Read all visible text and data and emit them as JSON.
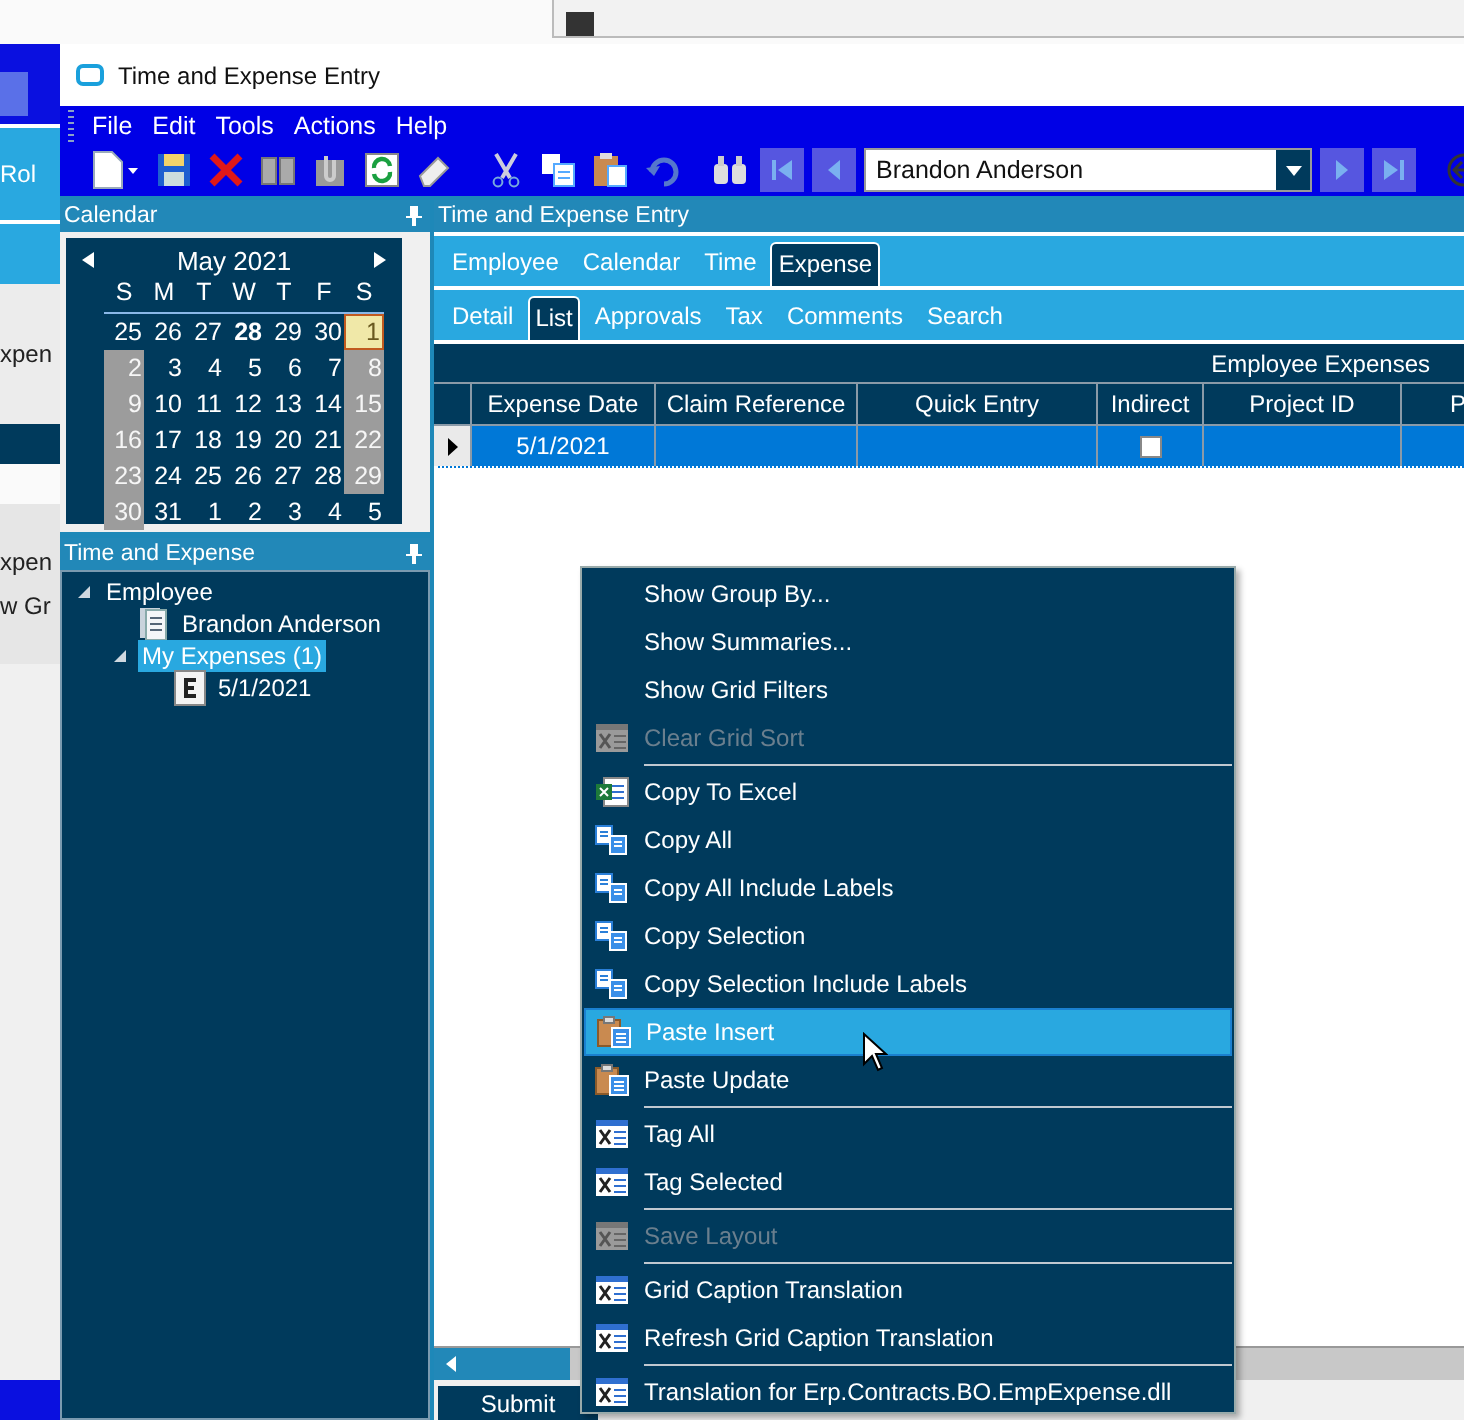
{
  "background_window": {
    "texts": [
      "Rol",
      "xpen",
      "xpen",
      "w Gr"
    ]
  },
  "window": {
    "title": "Time and Expense Entry"
  },
  "menu_bar": [
    "File",
    "Edit",
    "Tools",
    "Actions",
    "Help"
  ],
  "toolbar": {
    "record_selector": {
      "value": "Brandon Anderson"
    }
  },
  "calendar_panel": {
    "title": "Calendar",
    "month": "May 2021",
    "weekdays": [
      "S",
      "M",
      "T",
      "W",
      "T",
      "F",
      "S"
    ],
    "weeks": [
      [
        {
          "day": "25",
          "kind": "day",
          "selected": false
        },
        {
          "day": "26",
          "kind": "day",
          "selected": false
        },
        {
          "day": "27",
          "kind": "day",
          "selected": false
        },
        {
          "day": "28",
          "kind": "bold",
          "selected": false
        },
        {
          "day": "29",
          "kind": "day",
          "selected": false
        },
        {
          "day": "30",
          "kind": "day",
          "selected": false
        },
        {
          "day": "1",
          "kind": "weekend",
          "selected": true
        }
      ],
      [
        {
          "day": "2",
          "kind": "weekend",
          "selected": false
        },
        {
          "day": "3",
          "kind": "day",
          "selected": false
        },
        {
          "day": "4",
          "kind": "day",
          "selected": false
        },
        {
          "day": "5",
          "kind": "day",
          "selected": false
        },
        {
          "day": "6",
          "kind": "day",
          "selected": false
        },
        {
          "day": "7",
          "kind": "day",
          "selected": false
        },
        {
          "day": "8",
          "kind": "weekend",
          "selected": false
        }
      ],
      [
        {
          "day": "9",
          "kind": "weekend",
          "selected": false
        },
        {
          "day": "10",
          "kind": "day",
          "selected": false
        },
        {
          "day": "11",
          "kind": "day",
          "selected": false
        },
        {
          "day": "12",
          "kind": "day",
          "selected": false
        },
        {
          "day": "13",
          "kind": "day",
          "selected": false
        },
        {
          "day": "14",
          "kind": "day",
          "selected": false
        },
        {
          "day": "15",
          "kind": "weekend",
          "selected": false
        }
      ],
      [
        {
          "day": "16",
          "kind": "weekend",
          "selected": false
        },
        {
          "day": "17",
          "kind": "day",
          "selected": false
        },
        {
          "day": "18",
          "kind": "day",
          "selected": false
        },
        {
          "day": "19",
          "kind": "day",
          "selected": false
        },
        {
          "day": "20",
          "kind": "day",
          "selected": false
        },
        {
          "day": "21",
          "kind": "day",
          "selected": false
        },
        {
          "day": "22",
          "kind": "weekend",
          "selected": false
        }
      ],
      [
        {
          "day": "23",
          "kind": "weekend",
          "selected": false
        },
        {
          "day": "24",
          "kind": "day",
          "selected": false
        },
        {
          "day": "25",
          "kind": "day",
          "selected": false
        },
        {
          "day": "26",
          "kind": "day",
          "selected": false
        },
        {
          "day": "27",
          "kind": "day",
          "selected": false
        },
        {
          "day": "28",
          "kind": "day",
          "selected": false
        },
        {
          "day": "29",
          "kind": "weekend",
          "selected": false
        }
      ],
      [
        {
          "day": "30",
          "kind": "weekend",
          "selected": false
        },
        {
          "day": "31",
          "kind": "day",
          "selected": false
        },
        {
          "day": "1",
          "kind": "day",
          "selected": false
        },
        {
          "day": "2",
          "kind": "day",
          "selected": false
        },
        {
          "day": "3",
          "kind": "day",
          "selected": false
        },
        {
          "day": "4",
          "kind": "day",
          "selected": false
        },
        {
          "day": "5",
          "kind": "day",
          "selected": false
        }
      ]
    ]
  },
  "tree_panel": {
    "title": "Time and Expense",
    "items": [
      {
        "label": "Employee",
        "expanded": true,
        "selected": false,
        "children": [
          {
            "label": "Brandon Anderson",
            "kind": "employee",
            "selected": false
          },
          {
            "label": "My Expenses (1)",
            "expanded": true,
            "selected": true,
            "children": [
              {
                "label": "5/1/2021",
                "kind": "expense",
                "selected": false
              }
            ]
          }
        ]
      }
    ]
  },
  "entry_panel": {
    "title": "Time and Expense Entry",
    "tabs": [
      {
        "label": "Employee",
        "selected": false
      },
      {
        "label": "Calendar",
        "selected": false
      },
      {
        "label": "Time",
        "selected": false
      },
      {
        "label": "Expense",
        "selected": true
      }
    ],
    "subtabs": [
      {
        "label": "Detail",
        "selected": false
      },
      {
        "label": "List",
        "selected": true
      },
      {
        "label": "Approvals",
        "selected": false
      },
      {
        "label": "Tax",
        "selected": false
      },
      {
        "label": "Comments",
        "selected": false
      },
      {
        "label": "Search",
        "selected": false
      }
    ],
    "grid": {
      "group_header": "Employee Expenses",
      "columns": [
        "Expense Date",
        "Claim Reference",
        "Quick Entry",
        "Indirect",
        "Project ID",
        "P"
      ],
      "rows": [
        {
          "selected": true,
          "expense_date": "5/1/2021",
          "indirect": false
        }
      ]
    },
    "buttons": [
      "Submit"
    ]
  },
  "context_menu": [
    {
      "label": "Show Group By...",
      "kind": "none",
      "disabled": false,
      "selected": false,
      "separator_before": false
    },
    {
      "label": "Show Summaries...",
      "kind": "none",
      "disabled": false,
      "selected": false,
      "separator_before": false
    },
    {
      "label": "Show Grid Filters",
      "kind": "none",
      "disabled": false,
      "selected": false,
      "separator_before": false
    },
    {
      "label": "Clear Grid Sort",
      "kind": "tag",
      "disabled": true,
      "selected": false,
      "separator_before": false
    },
    {
      "label": "Copy To Excel",
      "kind": "excel",
      "disabled": false,
      "selected": false,
      "separator_before": true
    },
    {
      "label": "Copy All",
      "kind": "copy",
      "disabled": false,
      "selected": false,
      "separator_before": false
    },
    {
      "label": "Copy All Include Labels",
      "kind": "copy",
      "disabled": false,
      "selected": false,
      "separator_before": false
    },
    {
      "label": "Copy Selection",
      "kind": "copy",
      "disabled": false,
      "selected": false,
      "separator_before": false
    },
    {
      "label": "Copy Selection Include Labels",
      "kind": "copy",
      "disabled": false,
      "selected": false,
      "separator_before": false
    },
    {
      "label": "Paste Insert",
      "kind": "paste",
      "disabled": false,
      "selected": true,
      "separator_before": false
    },
    {
      "label": "Paste Update",
      "kind": "paste",
      "disabled": false,
      "selected": false,
      "separator_before": false
    },
    {
      "label": "Tag All",
      "kind": "tag",
      "disabled": false,
      "selected": false,
      "separator_before": true
    },
    {
      "label": "Tag Selected",
      "kind": "tag",
      "disabled": false,
      "selected": false,
      "separator_before": false
    },
    {
      "label": "Save Layout",
      "kind": "tag",
      "disabled": true,
      "selected": false,
      "separator_before": true
    },
    {
      "label": "Grid Caption Translation",
      "kind": "tag",
      "disabled": false,
      "selected": false,
      "separator_before": true
    },
    {
      "label": "Refresh Grid Caption Translation",
      "kind": "tag",
      "disabled": false,
      "selected": false,
      "separator_before": false
    },
    {
      "label": "Translation for Erp.Contracts.BO.EmpExpense.dll",
      "kind": "tag",
      "disabled": false,
      "selected": false,
      "separator_before": true
    }
  ]
}
